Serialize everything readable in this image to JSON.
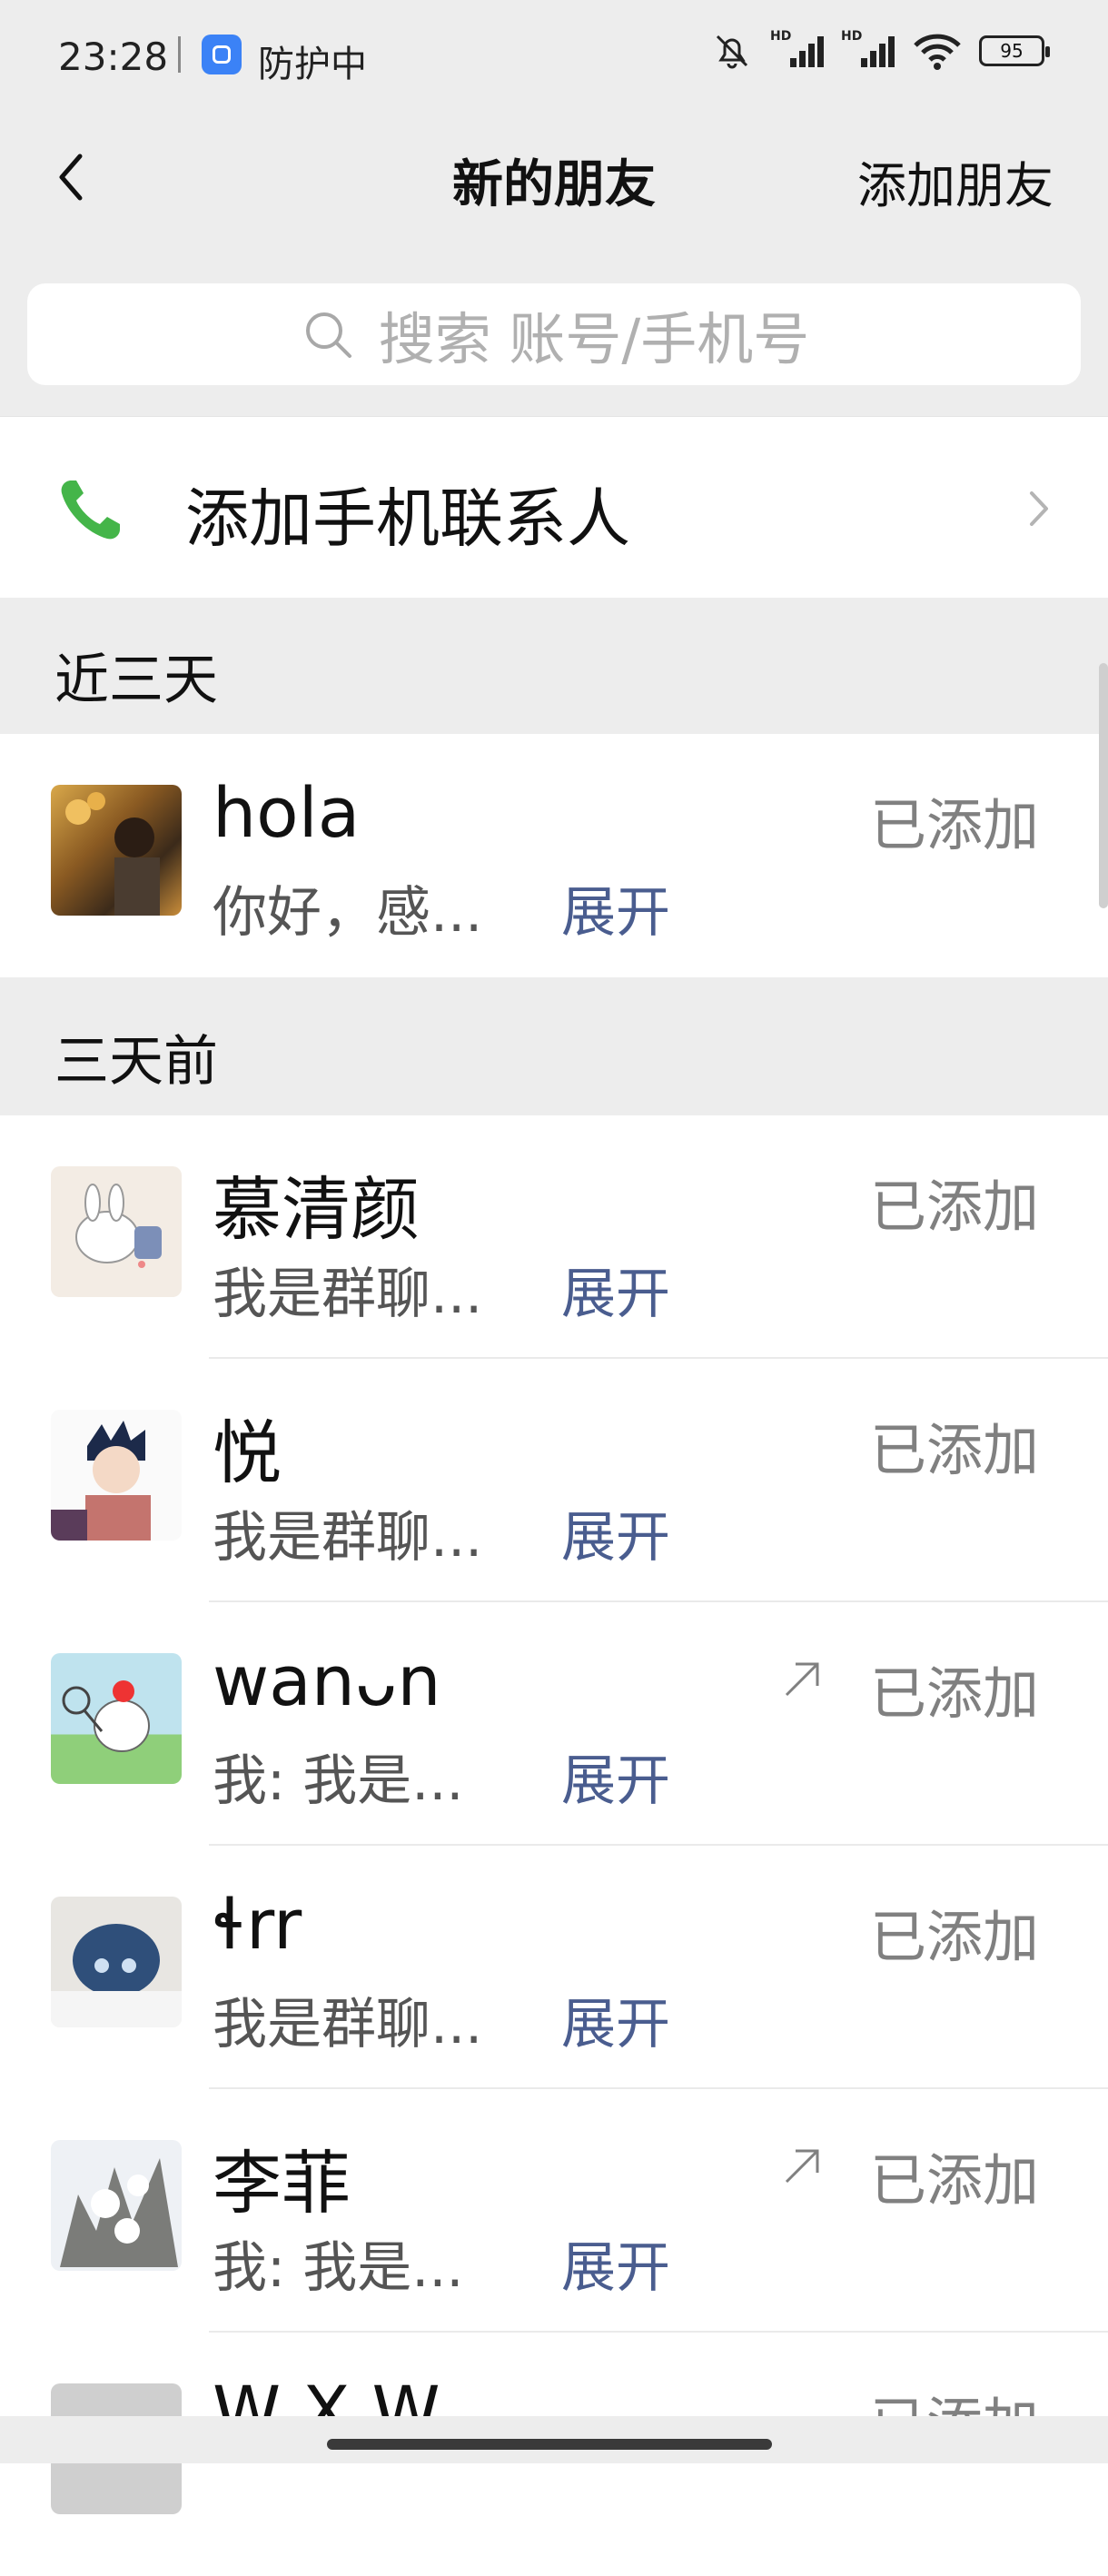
{
  "status_bar": {
    "time": "23:28",
    "protect_label": "防护中",
    "battery": "95",
    "sim_labels": [
      "HD",
      "HD"
    ]
  },
  "nav": {
    "title": "新的朋友",
    "action": "添加朋友",
    "back_icon": "chevron-left-icon"
  },
  "search": {
    "placeholder": "搜索 账号/手机号",
    "icon": "search-icon"
  },
  "add_phone": {
    "label": "添加手机联系人",
    "icon": "phone-icon"
  },
  "sections": [
    {
      "title": "近三天"
    },
    {
      "title": "三天前"
    }
  ],
  "recent": [
    {
      "name": "hola",
      "message": "你好，感...",
      "expand": "展开",
      "status": "已添加",
      "shared": false
    }
  ],
  "older": [
    {
      "name": "慕清颜",
      "message": "我是群聊...",
      "expand": "展开",
      "status": "已添加",
      "shared": false
    },
    {
      "name": "悦",
      "message": "我是群聊...",
      "expand": "展开",
      "status": "已添加",
      "shared": false
    },
    {
      "name": "wanᴗn",
      "message": "我: 我是...",
      "expand": "展开",
      "status": "已添加",
      "shared": true
    },
    {
      "name": "ɬrr",
      "message": "我是群聊...",
      "expand": "展开",
      "status": "已添加",
      "shared": false
    },
    {
      "name": "李菲",
      "message": "我: 我是...",
      "expand": "展开",
      "status": "已添加",
      "shared": true
    },
    {
      "name": "W X W",
      "message": "",
      "expand": "",
      "status": "已添加",
      "shared": false
    }
  ],
  "colors": {
    "background": "#ededed",
    "link": "#4a5d8f",
    "phone_green": "#44b549",
    "status_gray": "#808080"
  }
}
